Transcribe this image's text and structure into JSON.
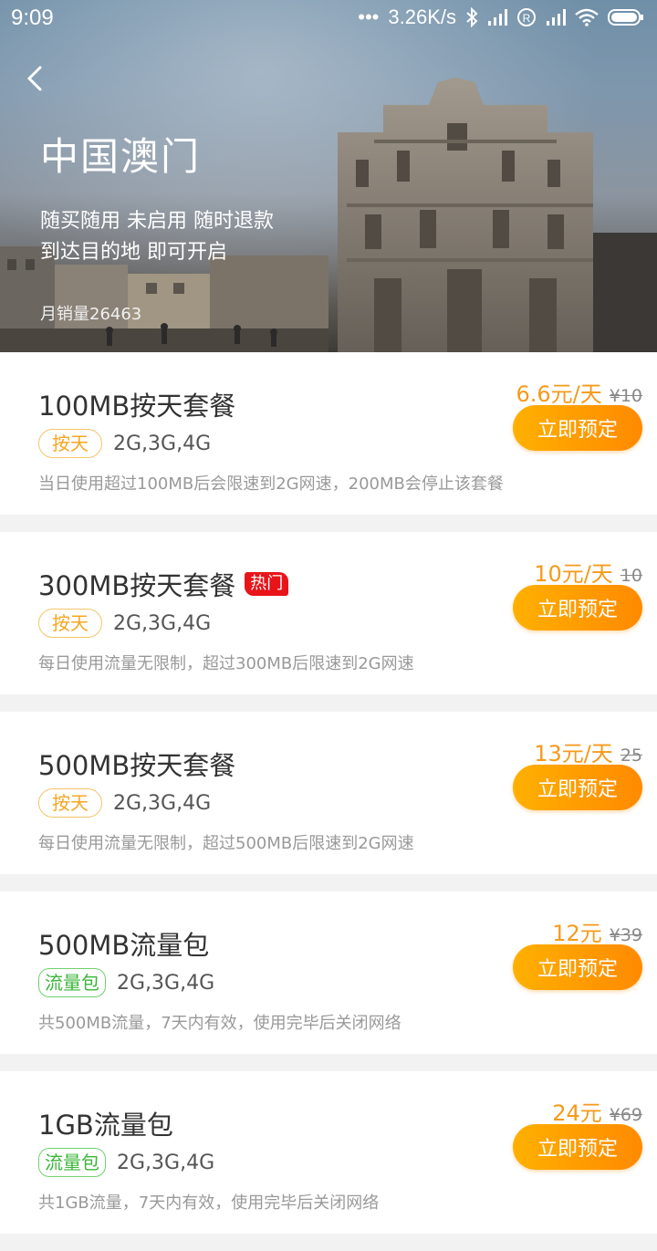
{
  "status": {
    "time": "9:09",
    "speed": "3.26K/s",
    "icons": [
      "dots-icon",
      "bluetooth-icon",
      "signal-icon",
      "roaming-icon",
      "signal-icon",
      "wifi-icon",
      "battery-icon"
    ]
  },
  "hero": {
    "title": "中国澳门",
    "subtitle_line1": "随买随用 未启用 随时退款",
    "subtitle_line2": "到达目的地 即可开启",
    "sales": "月销量26463"
  },
  "book_label": "立即预定",
  "colors": {
    "accent": "#f59a1b",
    "button_start": "#ffb000",
    "button_end": "#ff8a00",
    "hot": "#e8141a",
    "pack_tag": "#3bb53b",
    "day_tag": "#f5a623"
  },
  "plans": [
    {
      "title": "100MB按天套餐",
      "hot": "",
      "tag": "按天",
      "networks": "2G,3G,4G",
      "desc": "当日使用超过100MB后会限速到2G网速，200MB会停止该套餐",
      "price": "6.6元/天",
      "original": "¥10"
    },
    {
      "title": "300MB按天套餐",
      "hot": "热门",
      "tag": "按天",
      "networks": "2G,3G,4G",
      "desc": "每日使用流量无限制，超过300MB后限速到2G网速",
      "price": "10元/天",
      "original": "10"
    },
    {
      "title": "500MB按天套餐",
      "hot": "",
      "tag": "按天",
      "networks": "2G,3G,4G",
      "desc": "每日使用流量无限制，超过500MB后限速到2G网速",
      "price": "13元/天",
      "original": "25"
    },
    {
      "title": "500MB流量包",
      "hot": "",
      "tag": "流量包",
      "networks": "2G,3G,4G",
      "desc": "共500MB流量，7天内有效，使用完毕后关闭网络",
      "price": "12元",
      "original": "¥39"
    },
    {
      "title": "1GB流量包",
      "hot": "",
      "tag": "流量包",
      "networks": "2G,3G,4G",
      "desc": "共1GB流量，7天内有效，使用完毕后关闭网络",
      "price": "24元",
      "original": "¥69"
    }
  ]
}
